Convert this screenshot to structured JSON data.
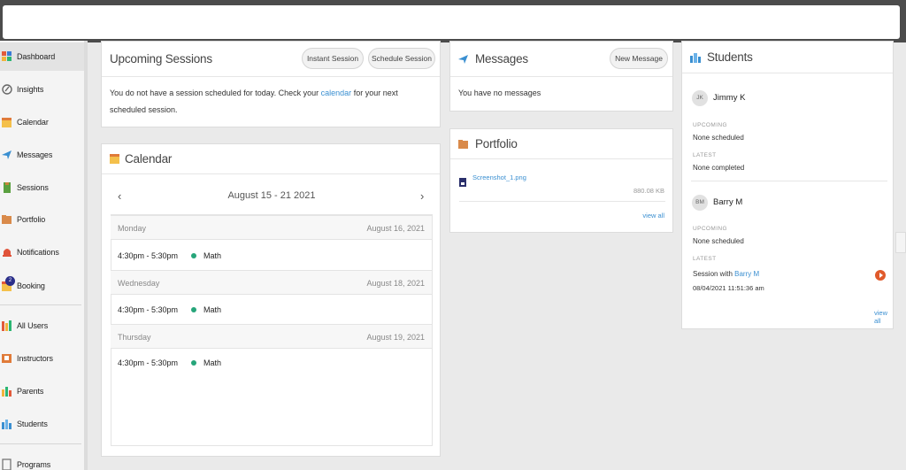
{
  "sidebar": {
    "items": [
      {
        "label": "Dashboard",
        "icon": "dashboard-icon",
        "active": true
      },
      {
        "label": "Insights",
        "icon": "insights-icon"
      },
      {
        "label": "Calendar",
        "icon": "calendar-icon"
      },
      {
        "label": "Messages",
        "icon": "messages-icon"
      },
      {
        "label": "Sessions",
        "icon": "sessions-icon"
      },
      {
        "label": "Portfolio",
        "icon": "portfolio-icon"
      },
      {
        "label": "Notifications",
        "icon": "bell-icon",
        "badge": "2"
      },
      {
        "label": "Booking",
        "icon": "booking-icon"
      },
      {
        "label": "All Users",
        "icon": "all-users-icon"
      },
      {
        "label": "Instructors",
        "icon": "instructors-icon"
      },
      {
        "label": "Parents",
        "icon": "parents-icon"
      },
      {
        "label": "Students",
        "icon": "students-icon"
      },
      {
        "label": "Programs",
        "icon": "programs-icon"
      }
    ]
  },
  "upcoming": {
    "title": "Upcoming Sessions",
    "instant_label": "Instant Session",
    "schedule_label": "Schedule Session",
    "text_before": "You do not have a session scheduled for today. Check your ",
    "link": "calendar",
    "text_after": " for your next scheduled session."
  },
  "calendar": {
    "title": "Calendar",
    "range": "August 15 - 21 2021",
    "prev": "‹",
    "next": "›",
    "days": [
      {
        "day": "Monday",
        "date": "August 16, 2021",
        "time": "4:30pm - 5:30pm",
        "subject": "Math"
      },
      {
        "day": "Wednesday",
        "date": "August 18, 2021",
        "time": "4:30pm - 5:30pm",
        "subject": "Math"
      },
      {
        "day": "Thursday",
        "date": "August 19, 2021",
        "time": "4:30pm - 5:30pm",
        "subject": "Math"
      }
    ]
  },
  "messages": {
    "title": "Messages",
    "new_label": "New Message",
    "empty": "You have no messages"
  },
  "portfolio": {
    "title": "Portfolio",
    "file_name": "Screenshot_1.png",
    "file_size": "880.08 KB",
    "view_all": "view all"
  },
  "students": {
    "title": "Students",
    "list": [
      {
        "initials": "JK",
        "name": "Jimmy K",
        "upcoming_label": "UPCOMING",
        "upcoming": "None scheduled",
        "latest_label": "LATEST",
        "latest": "None completed"
      },
      {
        "initials": "BM",
        "name": "Barry M",
        "upcoming_label": "UPCOMING",
        "upcoming": "None scheduled",
        "latest_label": "LATEST",
        "latest_prefix": "Session with ",
        "latest_link": "Barry M",
        "latest_time": "08/04/2021 11:51:36 am"
      }
    ],
    "view_all": "view all"
  },
  "colors": {
    "accent": "#3a8fd1",
    "dot": "#26a57a",
    "play": "#e05a2b",
    "badge": "#2b2f8a"
  }
}
